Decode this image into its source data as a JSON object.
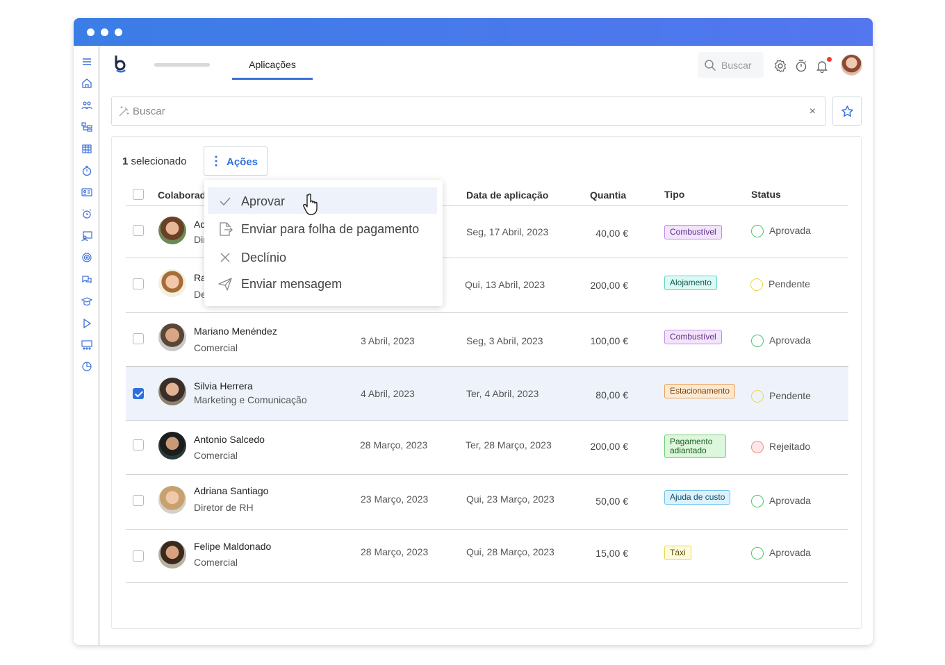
{
  "app": {
    "tab": "Aplicações",
    "search_placeholder": "Buscar",
    "filter_placeholder": "Buscar",
    "clear_symbol": "×"
  },
  "toolbar": {
    "selected_count": "1",
    "selected_text": " selecionado",
    "actions_label": "Ações"
  },
  "table": {
    "columns": [
      "Colaborador",
      "Data de aplicação",
      "Quantia",
      "Tipo",
      "Status"
    ],
    "rows": [
      {
        "name": "Ad",
        "dept": "Dir",
        "date": "",
        "applied": "Seg, 17 Abril, 2023",
        "amount": "40,00 €",
        "type": "Combustível",
        "status": "Aprovada",
        "checked": false
      },
      {
        "name": "Ra",
        "dept": "De",
        "date": "",
        "applied": "Qui, 13 Abril, 2023",
        "amount": "200,00 €",
        "type": "Alojamento",
        "status": "Pendente",
        "checked": false
      },
      {
        "name": "Mariano Menéndez",
        "dept": "Comercial",
        "date": "3 Abril, 2023",
        "applied": "Seg, 3 Abril, 2023",
        "amount": "100,00 €",
        "type": "Combustível",
        "status": "Aprovada",
        "checked": false
      },
      {
        "name": "Silvia Herrera",
        "dept": "Marketing e Comunicação",
        "date": "4 Abril, 2023",
        "applied": "Ter, 4 Abril, 2023",
        "amount": "80,00 €",
        "type": "Estacionamento",
        "status": "Pendente",
        "checked": true
      },
      {
        "name": "Antonio Salcedo",
        "dept": "Comercial",
        "date": "28 Março, 2023",
        "applied": "Ter, 28 Março, 2023",
        "amount": "200,00 €",
        "type": "Pagamento adiantado",
        "status": "Rejeitado",
        "checked": false
      },
      {
        "name": "Adriana Santiago",
        "dept": "Diretor de RH",
        "date": "23 Março, 2023",
        "applied": "Qui, 23 Março, 2023",
        "amount": "50,00 €",
        "type": "Ajuda de custo",
        "status": "Aprovada",
        "checked": false
      },
      {
        "name": "Felipe Maldonado",
        "dept": "Comercial",
        "date": "28 Março, 2023",
        "applied": "Qui, 28 Março, 2023",
        "amount": "15,00 €",
        "type": "Táxi",
        "status": "Aprovada",
        "checked": false
      }
    ]
  },
  "dropdown": {
    "items": [
      {
        "label": "Aprovar",
        "icon": "check-icon"
      },
      {
        "label": "Enviar para folha de pagamento",
        "icon": "export-icon"
      },
      {
        "label": "Declínio",
        "icon": "close-icon"
      },
      {
        "label": "Enviar mensagem",
        "icon": "send-icon"
      }
    ]
  },
  "colors": {
    "accent": "#2f6ee0",
    "titlebar_start": "#3b7de6",
    "titlebar_end": "#5476ef",
    "status_approved": "#4cc46a",
    "status_pending": "#e9d84a",
    "status_rejected": "#f08a8a"
  }
}
